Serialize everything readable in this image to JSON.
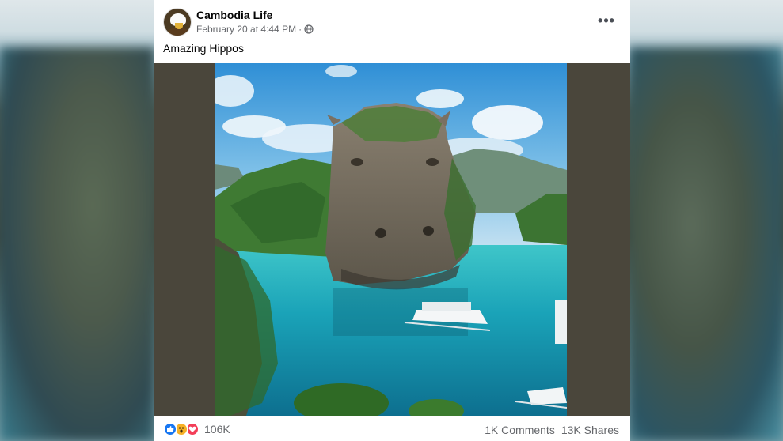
{
  "post": {
    "page_name": "Cambodia Life",
    "timestamp": "February 20 at 4:44 PM",
    "separator": "·",
    "audience_icon": "globe-icon",
    "more_label": "•••",
    "caption": "Amazing Hippos"
  },
  "engagement": {
    "reactions": [
      "like",
      "wow",
      "love"
    ],
    "reaction_count": "106K",
    "comments": "1K Comments",
    "shares": "13K Shares"
  },
  "colors": {
    "like": "#1877f2",
    "wow": "#f7b125",
    "love": "#f33e58",
    "secondary_text": "#65676b"
  }
}
